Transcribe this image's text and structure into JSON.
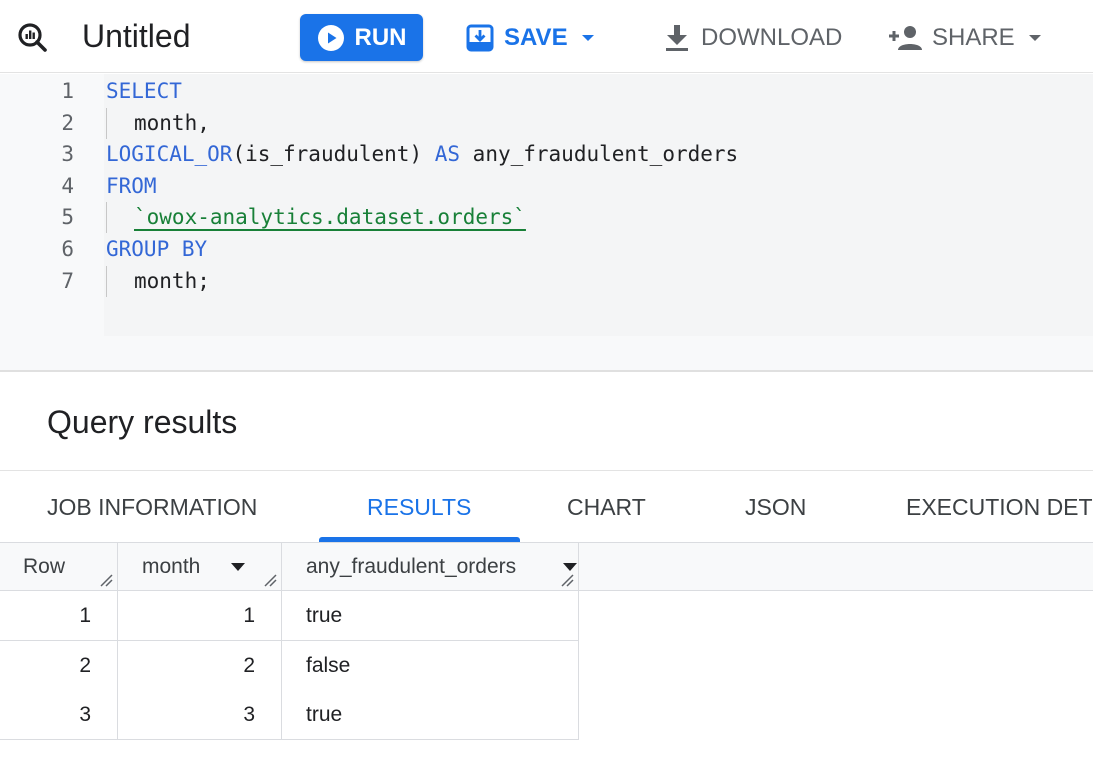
{
  "toolbar": {
    "title": "Untitled",
    "run_label": "RUN",
    "save_label": "SAVE",
    "download_label": "DOWNLOAD",
    "share_label": "SHARE",
    "icons": {
      "query": "query-magnifier-icon",
      "run": "play-circle-icon",
      "save": "save-icon",
      "download": "download-icon",
      "share": "person-add-icon",
      "dropdown": "caret-down-icon"
    }
  },
  "editor": {
    "lines": [
      {
        "number": "1",
        "parts": [
          {
            "text": "SELECT",
            "kind": "kw"
          }
        ]
      },
      {
        "number": "2",
        "parts": [
          {
            "text": "month,",
            "kind": "plain"
          }
        ]
      },
      {
        "number": "3",
        "parts": [
          {
            "text": "LOGICAL_OR",
            "kind": "kw"
          },
          {
            "text": "(is_fraudulent) ",
            "kind": "plain"
          },
          {
            "text": "AS",
            "kind": "kw"
          },
          {
            "text": " any_fraudulent_orders",
            "kind": "plain"
          }
        ]
      },
      {
        "number": "4",
        "parts": [
          {
            "text": "FROM",
            "kind": "kw"
          }
        ]
      },
      {
        "number": "5",
        "parts": [
          {
            "text": "`owox-analytics.dataset.orders`",
            "kind": "str"
          }
        ]
      },
      {
        "number": "6",
        "parts": [
          {
            "text": "GROUP BY",
            "kind": "kw"
          }
        ]
      },
      {
        "number": "7",
        "parts": [
          {
            "text": "month;",
            "kind": "plain"
          }
        ]
      }
    ]
  },
  "results": {
    "title": "Query results",
    "tabs": [
      {
        "label": "JOB INFORMATION",
        "active": false
      },
      {
        "label": "RESULTS",
        "active": true
      },
      {
        "label": "CHART",
        "active": false
      },
      {
        "label": "JSON",
        "active": false
      },
      {
        "label": "EXECUTION DET",
        "active": false
      }
    ],
    "table": {
      "columns": [
        "Row",
        "month",
        "any_fraudulent_orders"
      ],
      "rows": [
        [
          "1",
          "1",
          "true"
        ],
        [
          "2",
          "2",
          "false"
        ],
        [
          "3",
          "3",
          "true"
        ]
      ]
    }
  },
  "colors": {
    "accent": "#1a73e8",
    "keyword": "#3367d6",
    "string": "#188038",
    "muted": "#5f6368"
  }
}
